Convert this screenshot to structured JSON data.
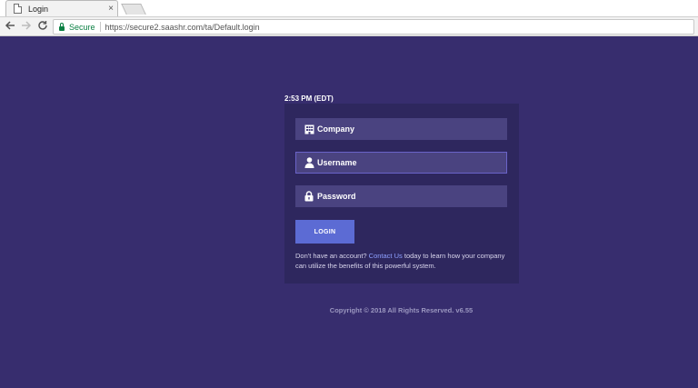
{
  "browser": {
    "tab_title": "Login",
    "tab_close": "×",
    "secure_label": "Secure",
    "url": "https://secure2.saashr.com/ta/Default.login"
  },
  "page": {
    "time": "2:53 PM (EDT)",
    "fields": {
      "company": "Company",
      "username": "Username",
      "password": "Password"
    },
    "login_label": "LOGIN",
    "signup_pre": "Don't have an account?",
    "contact_link": "Contact Us",
    "signup_post": "today to learn how your company can utilize the benefits of this powerful system.",
    "copyright": "Copyright © 2018 All Rights Reserved. v6.55"
  },
  "colors": {
    "background": "#372d6e",
    "card": "#2e275e",
    "field": "#4a4380",
    "button": "#5c6bd4",
    "link": "#8ea0ff"
  }
}
